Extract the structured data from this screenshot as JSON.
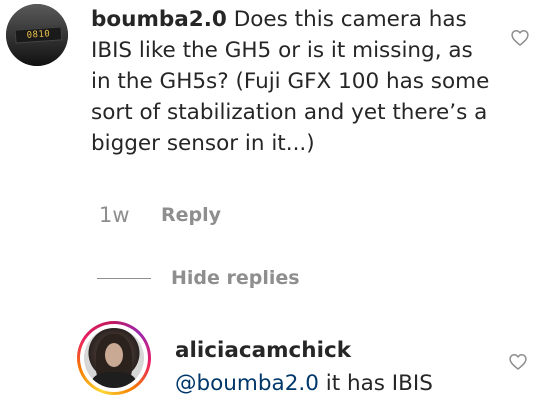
{
  "comments": [
    {
      "username": "boumba2.0",
      "text": "Does this camera has IBIS like the GH5 or is it missing, as in the GH5s? (Fuji GFX 100 has some sort of stabilization and yet there’s a bigger sensor in it...)",
      "time": "1w",
      "reply_label": "Reply",
      "avatar_display_text": "0810",
      "like_icon": "heart-outline-icon"
    }
  ],
  "replies_toggle": {
    "label": "Hide replies"
  },
  "reply": {
    "username": "aliciacamchick",
    "mention": "@boumba2.0",
    "text": " it has IBIS",
    "like_icon": "heart-outline-icon"
  },
  "colors": {
    "text": "#262626",
    "muted": "#8e8e8e",
    "mention": "#00376b",
    "story_ring": [
      "#fdd835",
      "#f57c00",
      "#e91e63",
      "#9c27b0"
    ]
  }
}
